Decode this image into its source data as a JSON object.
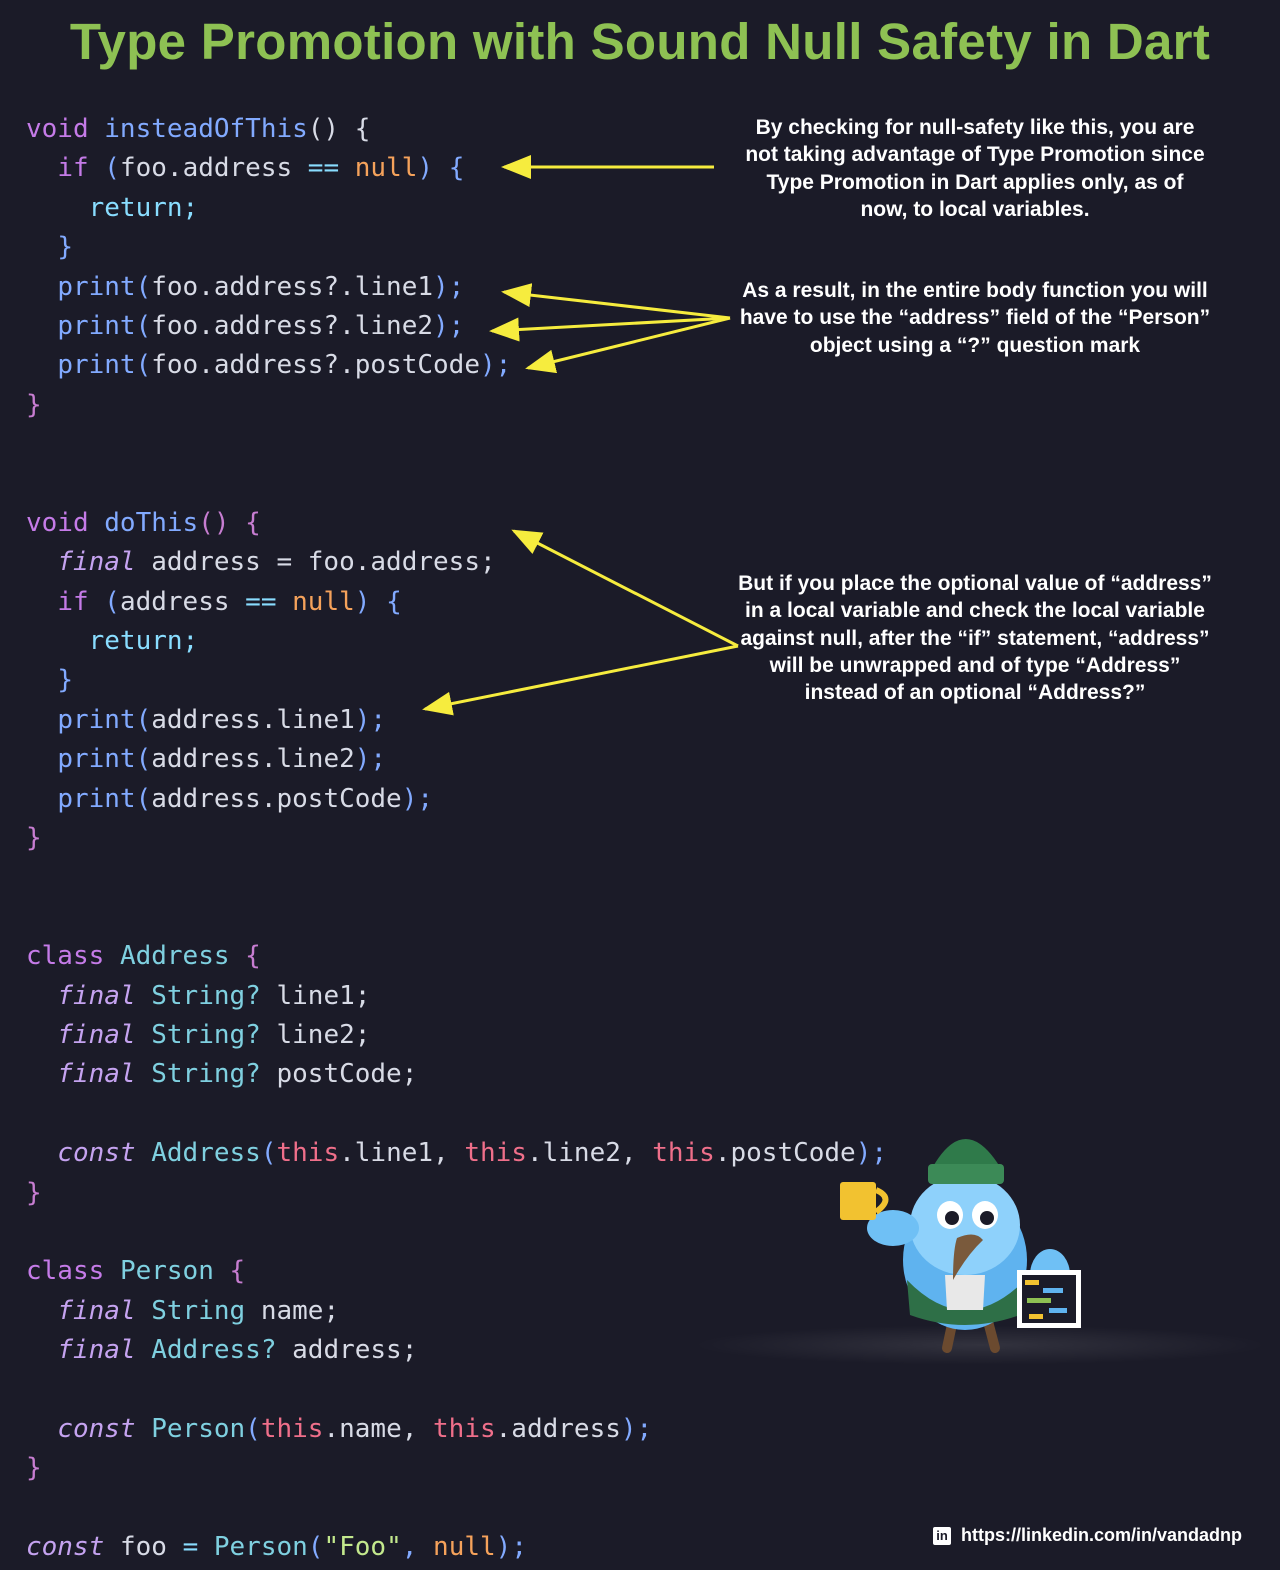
{
  "title": "Type Promotion with Sound Null Safety in Dart",
  "code": {
    "insteadOfThis": {
      "void": "void",
      "name": "insteadOfThis",
      "paren": "()",
      "brace": "{",
      "if": "if",
      "open_paren": "(",
      "foo": "foo",
      "dot": ".",
      "address": "address",
      "eq": "==",
      "null": "null",
      "close_paren_brace": ") {",
      "return": "return;",
      "close_inner": "}",
      "print": "print",
      "p_open": "(",
      "access": "foo.address?.",
      "line1": "line1",
      "line2": "line2",
      "postCode": "postCode",
      "p_close": ");",
      "close": "}"
    },
    "doThis": {
      "void": "void",
      "name": "doThis",
      "paren": "()",
      "brace": "{",
      "final": "final",
      "decl": "address = foo.address;",
      "if": "if",
      "open_paren": "(",
      "address": "address",
      "eq": "==",
      "null": "null",
      "close_paren_brace": ") {",
      "return": "return;",
      "close_inner": "}",
      "print": "print",
      "p_open": "(",
      "access": "address.",
      "line1": "line1",
      "line2": "line2",
      "postCode": "postCode",
      "p_close": ");",
      "close": "}"
    },
    "address_class": {
      "class": "class",
      "name": "Address",
      "brace": "{",
      "final": "final",
      "type": "String?",
      "f1": "line1;",
      "f2": "line2;",
      "f3": "postCode;",
      "const": "const",
      "ctor": "Address",
      "open": "(",
      "this": "this",
      "a1": ".line1, ",
      "a2": ".line2, ",
      "a3": ".postCode",
      "close_call": ");",
      "close": "}"
    },
    "person_class": {
      "class": "class",
      "name": "Person",
      "brace": "{",
      "final": "final",
      "type1": "String",
      "f1": "name;",
      "type2": "Address?",
      "f2": "address;",
      "const": "const",
      "ctor": "Person",
      "open": "(",
      "this": "this",
      "a1": ".name, ",
      "a2": ".address",
      "close_call": ");",
      "close": "}"
    },
    "foo_decl": {
      "const": "const",
      "name": "foo",
      "eq": "=",
      "ctor": "Person",
      "open": "(",
      "str": "\"Foo\"",
      "comma": ",",
      "null": "null",
      "close": ");"
    }
  },
  "annotations": {
    "note1": "By checking for null-safety like this, you are not taking advantage of Type Promotion since Type Promotion in Dart applies only, as of now, to local variables.",
    "note2": "As a result, in the entire body function you will have to use the “address” field of the “Person” object using a “?” question mark",
    "note3": "But if you place the optional value of “address” in a local variable and check the local variable against null, after the “if” statement, “address” will be unwrapped and of type “Address” instead of  an optional “Address?”"
  },
  "footer": {
    "icon": "linkedin-icon",
    "url": "https://linkedin.com/in/vandadnp"
  },
  "colors": {
    "background": "#1b1b28",
    "title": "#8ec153",
    "arrow": "#f6ec3e"
  }
}
